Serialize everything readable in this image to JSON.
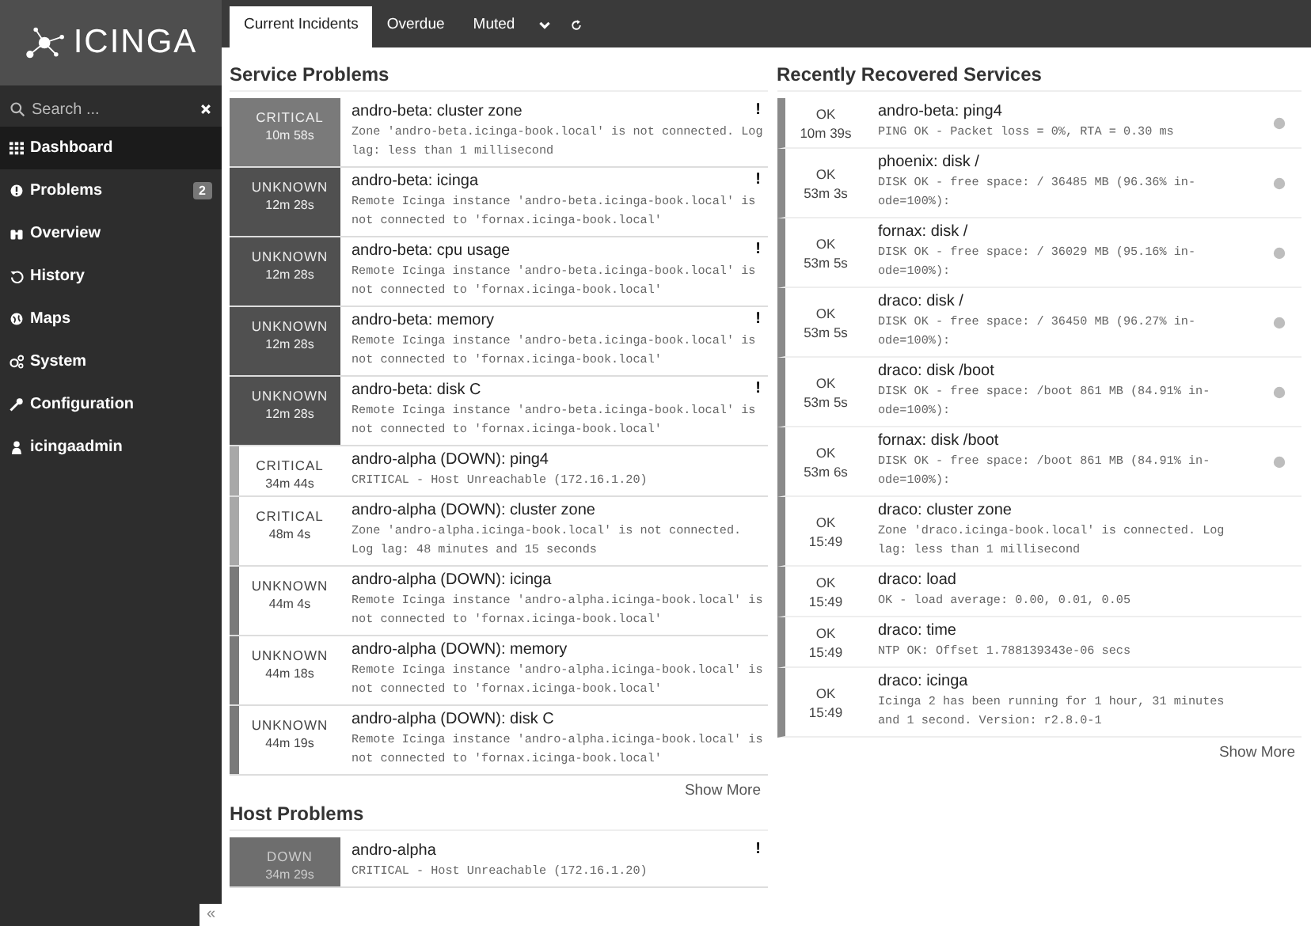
{
  "logo": "ICINGA",
  "sidebar": {
    "search": {
      "placeholder": "Search ..."
    },
    "items": [
      {
        "label": "Dashboard",
        "selected": true
      },
      {
        "label": "Problems",
        "selected": false,
        "badge": "2"
      },
      {
        "label": "Overview",
        "selected": false
      },
      {
        "label": "History",
        "selected": false
      },
      {
        "label": "Maps",
        "selected": false
      },
      {
        "label": "System",
        "selected": false
      },
      {
        "label": "Configuration",
        "selected": false
      },
      {
        "label": "icingaadmin",
        "selected": false
      }
    ],
    "collapse": "«"
  },
  "tabs": [
    {
      "label": "Current Incidents",
      "selected": true
    },
    {
      "label": "Overdue",
      "selected": false
    },
    {
      "label": "Muted",
      "selected": false
    }
  ],
  "service_problems": {
    "title": "Service Problems",
    "rows": [
      {
        "state": "CRITICAL",
        "since": "10m 58s",
        "handled": false,
        "color": "#7a7a7a",
        "name": "andro-beta: cluster zone",
        "output": "Zone 'andro-beta.icinga-book.local' is not connected. Log lag: less than 1 millisecond",
        "flag": "!"
      },
      {
        "state": "UNKNOWN",
        "since": "12m 28s",
        "handled": false,
        "color": "#505050",
        "name": "andro-beta: icinga",
        "output": "Remote Icinga instance 'andro-beta.icinga-book.local' is not connected to 'fornax.icinga-book.local'",
        "flag": "!"
      },
      {
        "state": "UNKNOWN",
        "since": "12m 28s",
        "handled": false,
        "color": "#505050",
        "name": "andro-beta: cpu usage",
        "output": "Remote Icinga instance 'andro-beta.icinga-book.local' is not connected to 'fornax.icinga-book.local'",
        "flag": "!"
      },
      {
        "state": "UNKNOWN",
        "since": "12m 28s",
        "handled": false,
        "color": "#505050",
        "name": "andro-beta: memory",
        "output": "Remote Icinga instance 'andro-beta.icinga-book.local' is not connected to 'fornax.icinga-book.local'",
        "flag": "!"
      },
      {
        "state": "UNKNOWN",
        "since": "12m 28s",
        "handled": false,
        "color": "#505050",
        "name": "andro-beta: disk C",
        "output": "Remote Icinga instance 'andro-beta.icinga-book.local' is not connected to 'fornax.icinga-book.local'",
        "flag": "!"
      },
      {
        "state": "CRITICAL",
        "since": "34m 44s",
        "handled": true,
        "color": "#a8a8a8",
        "name": "andro-alpha (DOWN): ping4",
        "output": "CRITICAL - Host Unreachable (172.16.1.20)"
      },
      {
        "state": "CRITICAL",
        "since": "48m 4s",
        "handled": true,
        "color": "#a8a8a8",
        "name": "andro-alpha (DOWN): cluster zone",
        "output": "Zone 'andro-alpha.icinga-book.local' is not connected. Log lag: 48 minutes and 15 seconds"
      },
      {
        "state": "UNKNOWN",
        "since": "44m 4s",
        "handled": true,
        "color": "#7a7a7a",
        "name": "andro-alpha (DOWN): icinga",
        "output": "Remote Icinga instance 'andro-alpha.icinga-book.local' is not connected to 'fornax.icinga-book.local'"
      },
      {
        "state": "UNKNOWN",
        "since": "44m 18s",
        "handled": true,
        "color": "#7a7a7a",
        "name": "andro-alpha (DOWN): memory",
        "output": "Remote Icinga instance 'andro-alpha.icinga-book.local' is not connected to 'fornax.icinga-book.local'"
      },
      {
        "state": "UNKNOWN",
        "since": "44m 19s",
        "handled": true,
        "color": "#7a7a7a",
        "name": "andro-alpha (DOWN): disk C",
        "output": "Remote Icinga instance 'andro-alpha.icinga-book.local' is not connected to 'fornax.icinga-book.local'"
      }
    ],
    "show_more": "Show More"
  },
  "host_problems": {
    "title": "Host Problems",
    "rows": [
      {
        "state": "DOWN",
        "since": "34m 29s",
        "handled": false,
        "color": "#6e6e6e",
        "name": "andro-alpha",
        "output": "CRITICAL - Host Unreachable (172.16.1.20)",
        "flag": "!"
      }
    ]
  },
  "recovered": {
    "title": "Recently Recovered Services",
    "rows": [
      {
        "state": "OK",
        "since": "10m 39s",
        "name": "andro-beta: ping4",
        "output": "PING OK - Packet loss = 0%, RTA = 0.30 ms",
        "graph": true
      },
      {
        "state": "OK",
        "since": "53m 3s",
        "name": "phoenix: disk /",
        "output": "DISK OK - free space: / 36485 MB (96.36% in-ode=100%):",
        "graph": true
      },
      {
        "state": "OK",
        "since": "53m 5s",
        "name": "fornax: disk /",
        "output": "DISK OK - free space: / 36029 MB (95.16% in-ode=100%):",
        "graph": true
      },
      {
        "state": "OK",
        "since": "53m 5s",
        "name": "draco: disk /",
        "output": "DISK OK - free space: / 36450 MB (96.27% in-ode=100%):",
        "graph": true
      },
      {
        "state": "OK",
        "since": "53m 5s",
        "name": "draco: disk /boot",
        "output": "DISK OK - free space: /boot 861 MB (84.91% in-ode=100%):",
        "graph": true
      },
      {
        "state": "OK",
        "since": "53m 6s",
        "name": "fornax: disk /boot",
        "output": "DISK OK - free space: /boot 861 MB (84.91% in-ode=100%):",
        "graph": true
      },
      {
        "state": "OK",
        "since": "15:49",
        "name": "draco: cluster zone",
        "output": "Zone 'draco.icinga-book.local' is connected. Log lag: less than 1 millisecond",
        "graph": false
      },
      {
        "state": "OK",
        "since": "15:49",
        "name": "draco: load",
        "output": "OK - load average: 0.00, 0.01, 0.05",
        "graph": false
      },
      {
        "state": "OK",
        "since": "15:49",
        "name": "draco: time",
        "output": "NTP OK: Offset 1.788139343e-06 secs",
        "graph": false
      },
      {
        "state": "OK",
        "since": "15:49",
        "name": "draco: icinga",
        "output": "Icinga 2 has been running for 1 hour, 31 minutes and 1 second. Version: r2.8.0-1",
        "graph": false
      }
    ],
    "show_more": "Show More"
  }
}
